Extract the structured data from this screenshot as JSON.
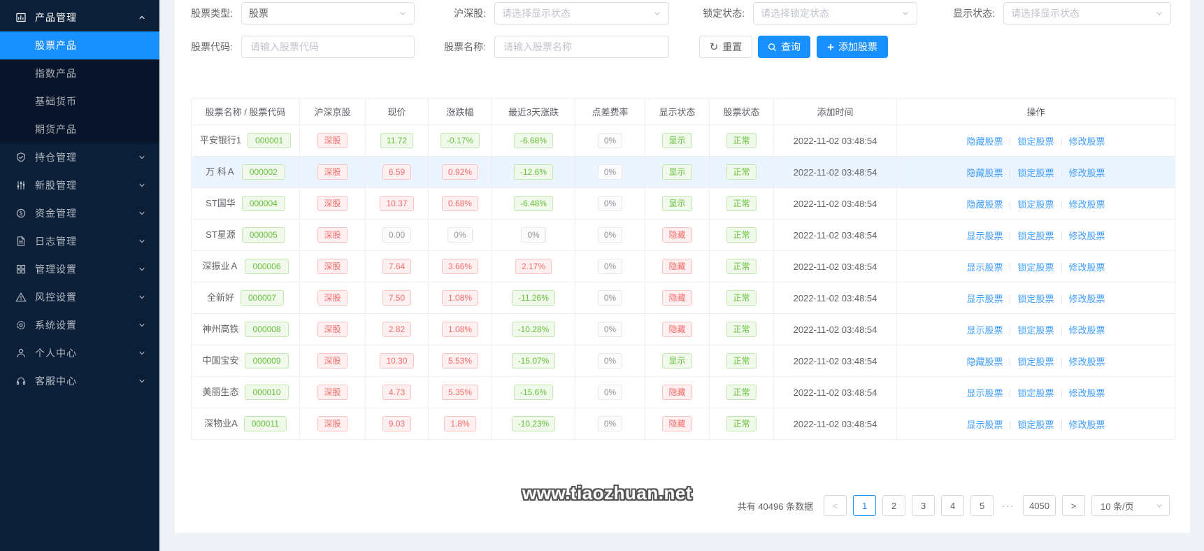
{
  "sidebar": {
    "menu": [
      {
        "label": "产品管理",
        "icon": "chart-icon",
        "state": "expanded",
        "children": [
          {
            "label": "股票产品",
            "active": true
          },
          {
            "label": "指数产品",
            "active": false
          },
          {
            "label": "基础货币",
            "active": false
          },
          {
            "label": "期货产品",
            "active": false
          }
        ]
      },
      {
        "label": "持仓管理",
        "icon": "positions-icon",
        "state": "collapsed"
      },
      {
        "label": "新股管理",
        "icon": "sliders-icon",
        "state": "collapsed"
      },
      {
        "label": "资金管理",
        "icon": "funds-icon",
        "state": "collapsed"
      },
      {
        "label": "日志管理",
        "icon": "log-icon",
        "state": "collapsed"
      },
      {
        "label": "管理设置",
        "icon": "grid-icon",
        "state": "collapsed"
      },
      {
        "label": "风控设置",
        "icon": "warning-icon",
        "state": "collapsed"
      },
      {
        "label": "系统设置",
        "icon": "gear-icon",
        "state": "collapsed"
      },
      {
        "label": "个人中心",
        "icon": "user-icon",
        "state": "collapsed"
      },
      {
        "label": "客服中心",
        "icon": "headset-icon",
        "state": "collapsed"
      }
    ]
  },
  "filters": {
    "stock_type": {
      "label": "股票类型:",
      "value": "股票"
    },
    "hs_market": {
      "label": "沪深股:",
      "placeholder": "请选择显示状态"
    },
    "lock_status": {
      "label": "锁定状态:",
      "placeholder": "请选择锁定状态"
    },
    "display_status": {
      "label": "显示状态:",
      "placeholder": "请选择显示状态"
    },
    "stock_code": {
      "label": "股票代码:",
      "placeholder": "请输入股票代码"
    },
    "stock_name": {
      "label": "股票名称:",
      "placeholder": "请输入股票名称"
    },
    "reset_label": "重置",
    "search_label": "查询",
    "add_label": "添加股票"
  },
  "table": {
    "headers": [
      "股票名称 / 股票代码",
      "沪深京股",
      "现价",
      "涨跌幅",
      "最近3天涨跌",
      "点差费率",
      "显示状态",
      "股票状态",
      "添加时间",
      "操作"
    ],
    "rows": [
      {
        "name": "平安银行1",
        "code": "000001",
        "market": "深股",
        "market_style": "red",
        "price": "11.72",
        "price_style": "green",
        "change": "-0.17%",
        "change_style": "green",
        "change3d": "-6.68%",
        "change3d_style": "green",
        "spread": "0%",
        "spread_style": "gray",
        "display": "显示",
        "display_style": "green",
        "status": "正常",
        "status_style": "green",
        "time": "2022-11-02 03:48:54",
        "actions": [
          "隐藏股票",
          "锁定股票",
          "修改股票"
        ],
        "highlight": false
      },
      {
        "name": "万 科Ａ",
        "code": "000002",
        "market": "深股",
        "market_style": "red",
        "price": "6.59",
        "price_style": "red",
        "change": "0.92%",
        "change_style": "red",
        "change3d": "-12.6%",
        "change3d_style": "green",
        "spread": "0%",
        "spread_style": "gray",
        "display": "显示",
        "display_style": "green",
        "status": "正常",
        "status_style": "green",
        "time": "2022-11-02 03:48:54",
        "actions": [
          "隐藏股票",
          "锁定股票",
          "修改股票"
        ],
        "highlight": true
      },
      {
        "name": "ST国华",
        "code": "000004",
        "market": "深股",
        "market_style": "red",
        "price": "10.37",
        "price_style": "red",
        "change": "0.68%",
        "change_style": "red",
        "change3d": "-6.48%",
        "change3d_style": "green",
        "spread": "0%",
        "spread_style": "gray",
        "display": "显示",
        "display_style": "green",
        "status": "正常",
        "status_style": "green",
        "time": "2022-11-02 03:48:54",
        "actions": [
          "隐藏股票",
          "锁定股票",
          "修改股票"
        ],
        "highlight": false
      },
      {
        "name": "ST星源",
        "code": "000005",
        "market": "深股",
        "market_style": "red",
        "price": "0.00",
        "price_style": "gray",
        "change": "0%",
        "change_style": "gray",
        "change3d": "0%",
        "change3d_style": "gray",
        "spread": "0%",
        "spread_style": "gray",
        "display": "隐藏",
        "display_style": "red",
        "status": "正常",
        "status_style": "green",
        "time": "2022-11-02 03:48:54",
        "actions": [
          "显示股票",
          "锁定股票",
          "修改股票"
        ],
        "highlight": false
      },
      {
        "name": "深振业Ａ",
        "code": "000006",
        "market": "深股",
        "market_style": "red",
        "price": "7.64",
        "price_style": "red",
        "change": "3.66%",
        "change_style": "red",
        "change3d": "2.17%",
        "change3d_style": "red",
        "spread": "0%",
        "spread_style": "gray",
        "display": "隐藏",
        "display_style": "red",
        "status": "正常",
        "status_style": "green",
        "time": "2022-11-02 03:48:54",
        "actions": [
          "显示股票",
          "锁定股票",
          "修改股票"
        ],
        "highlight": false
      },
      {
        "name": "全新好",
        "code": "000007",
        "market": "深股",
        "market_style": "red",
        "price": "7.50",
        "price_style": "red",
        "change": "1.08%",
        "change_style": "red",
        "change3d": "-11.26%",
        "change3d_style": "green",
        "spread": "0%",
        "spread_style": "gray",
        "display": "隐藏",
        "display_style": "red",
        "status": "正常",
        "status_style": "green",
        "time": "2022-11-02 03:48:54",
        "actions": [
          "显示股票",
          "锁定股票",
          "修改股票"
        ],
        "highlight": false
      },
      {
        "name": "神州高铁",
        "code": "000008",
        "market": "深股",
        "market_style": "red",
        "price": "2.82",
        "price_style": "red",
        "change": "1.08%",
        "change_style": "red",
        "change3d": "-10.28%",
        "change3d_style": "green",
        "spread": "0%",
        "spread_style": "gray",
        "display": "隐藏",
        "display_style": "red",
        "status": "正常",
        "status_style": "green",
        "time": "2022-11-02 03:48:54",
        "actions": [
          "显示股票",
          "锁定股票",
          "修改股票"
        ],
        "highlight": false
      },
      {
        "name": "中国宝安",
        "code": "000009",
        "market": "深股",
        "market_style": "red",
        "price": "10.30",
        "price_style": "red",
        "change": "5.53%",
        "change_style": "red",
        "change3d": "-15.07%",
        "change3d_style": "green",
        "spread": "0%",
        "spread_style": "gray",
        "display": "显示",
        "display_style": "green",
        "status": "正常",
        "status_style": "green",
        "time": "2022-11-02 03:48:54",
        "actions": [
          "隐藏股票",
          "锁定股票",
          "修改股票"
        ],
        "highlight": false
      },
      {
        "name": "美丽生态",
        "code": "000010",
        "market": "深股",
        "market_style": "red",
        "price": "4.73",
        "price_style": "red",
        "change": "5.35%",
        "change_style": "red",
        "change3d": "-15.6%",
        "change3d_style": "green",
        "spread": "0%",
        "spread_style": "gray",
        "display": "隐藏",
        "display_style": "red",
        "status": "正常",
        "status_style": "green",
        "time": "2022-11-02 03:48:54",
        "actions": [
          "显示股票",
          "锁定股票",
          "修改股票"
        ],
        "highlight": false
      },
      {
        "name": "深物业A",
        "code": "000011",
        "market": "深股",
        "market_style": "red",
        "price": "9.03",
        "price_style": "red",
        "change": "1.8%",
        "change_style": "red",
        "change3d": "-10.23%",
        "change3d_style": "green",
        "spread": "0%",
        "spread_style": "gray",
        "display": "隐藏",
        "display_style": "red",
        "status": "正常",
        "status_style": "green",
        "time": "2022-11-02 03:48:54",
        "actions": [
          "显示股票",
          "锁定股票",
          "修改股票"
        ],
        "highlight": false
      }
    ]
  },
  "pagination": {
    "total_text": "共有 40496 条数据",
    "prev_label": "<",
    "next_label": ">",
    "pages": [
      "1",
      "2",
      "3",
      "4",
      "5",
      "···",
      "4050"
    ],
    "active_page": "1",
    "page_size": "10 条/页"
  },
  "watermark": "www.tiaozhuan.net",
  "colors": {
    "accent": "#1890ff",
    "green": "#67c23a",
    "red": "#f56c6c",
    "gray": "#909399",
    "sidebar_bg": "#0c1f38"
  }
}
